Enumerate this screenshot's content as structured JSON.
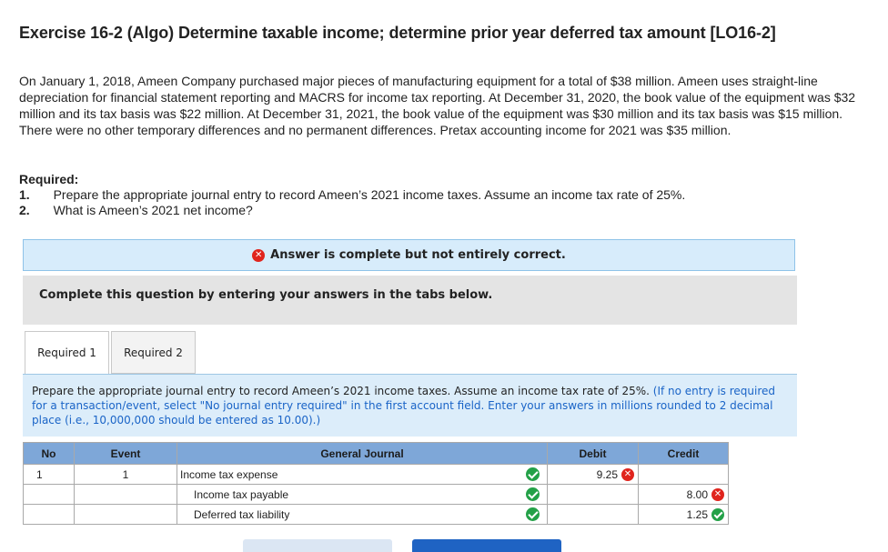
{
  "exercise": {
    "title": "Exercise 16-2 (Algo) Determine taxable income; determine prior year deferred tax amount [LO16-2]",
    "problem_text": "On January 1, 2018, Ameen Company purchased major pieces of manufacturing equipment for a total of $38 million. Ameen uses straight-line depreciation for financial statement reporting and MACRS for income tax reporting. At December 31, 2020, the book value of the equipment was $32 million and its tax basis was $22 million. At December 31, 2021, the book value of the equipment was $30 million and its tax basis was $15 million. There were no other temporary differences and no permanent differences. Pretax accounting income for 2021 was $35 million.",
    "required_header": "Required:",
    "required_items": [
      {
        "num": "1.",
        "text": "Prepare the appropriate journal entry to record Ameen’s 2021 income taxes. Assume an income tax rate of 25%."
      },
      {
        "num": "2.",
        "text": "What is Ameen’s 2021 net income?"
      }
    ]
  },
  "banner": {
    "text": "Answer is complete but not entirely correct.",
    "icon": "x-circle-icon"
  },
  "complete_text": "Complete this question by entering your answers in the tabs below.",
  "tabs": [
    {
      "label": "Required 1"
    },
    {
      "label": "Required 2"
    }
  ],
  "instruction": {
    "text": "Prepare the appropriate journal entry to record Ameen’s 2021 income taxes. Assume an income tax rate of 25%.",
    "hint": "(If no entry is required for a transaction/event, select \"No journal entry required\" in the first account field. Enter your answers in millions rounded to 2 decimal place (i.e., 10,000,000 should be entered as 10.00).)"
  },
  "journal": {
    "headers": {
      "no": "No",
      "event": "Event",
      "general_journal": "General Journal",
      "debit": "Debit",
      "credit": "Credit"
    },
    "rows": [
      {
        "no": "1",
        "event": "1",
        "account": "Income tax expense",
        "debit": "9.25",
        "credit": ""
      },
      {
        "no": "",
        "event": "",
        "account": "Income tax payable",
        "debit": "",
        "credit": "8.00"
      },
      {
        "no": "",
        "event": "",
        "account": "Deferred tax liability",
        "debit": "",
        "credit": "1.25"
      }
    ]
  },
  "colors": {
    "correct": "#24a148",
    "incorrect": "#e0241d",
    "accent": "#1f63c3"
  }
}
